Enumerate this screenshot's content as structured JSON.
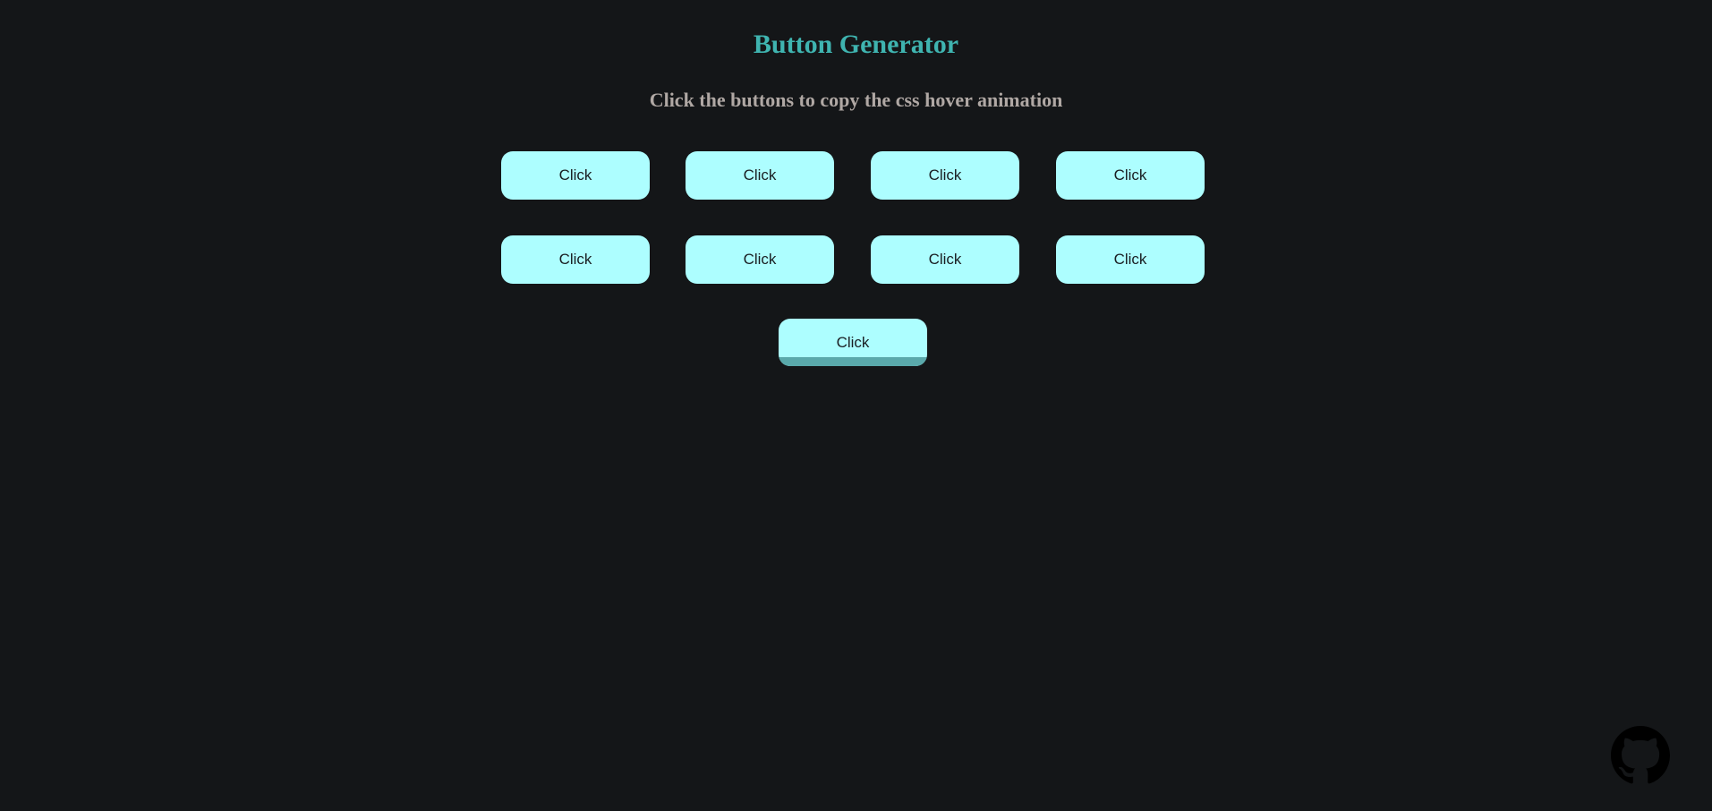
{
  "header": {
    "title": "Button Generator",
    "subtitle": "Click the buttons to copy the css hover animation"
  },
  "buttons": {
    "row1": [
      "Click",
      "Click",
      "Click",
      "Click"
    ],
    "row2": [
      "Click",
      "Click",
      "Click",
      "Click"
    ],
    "row3": [
      "Click"
    ]
  },
  "footer": {
    "github_icon": "github-icon"
  },
  "colors": {
    "background": "#141618",
    "title": "#3fb4b0",
    "subtitle": "#b0a8a4",
    "button_bg": "#adfeff",
    "button_text": "#1a1e22",
    "hover_fill": "#5aa9ab"
  }
}
